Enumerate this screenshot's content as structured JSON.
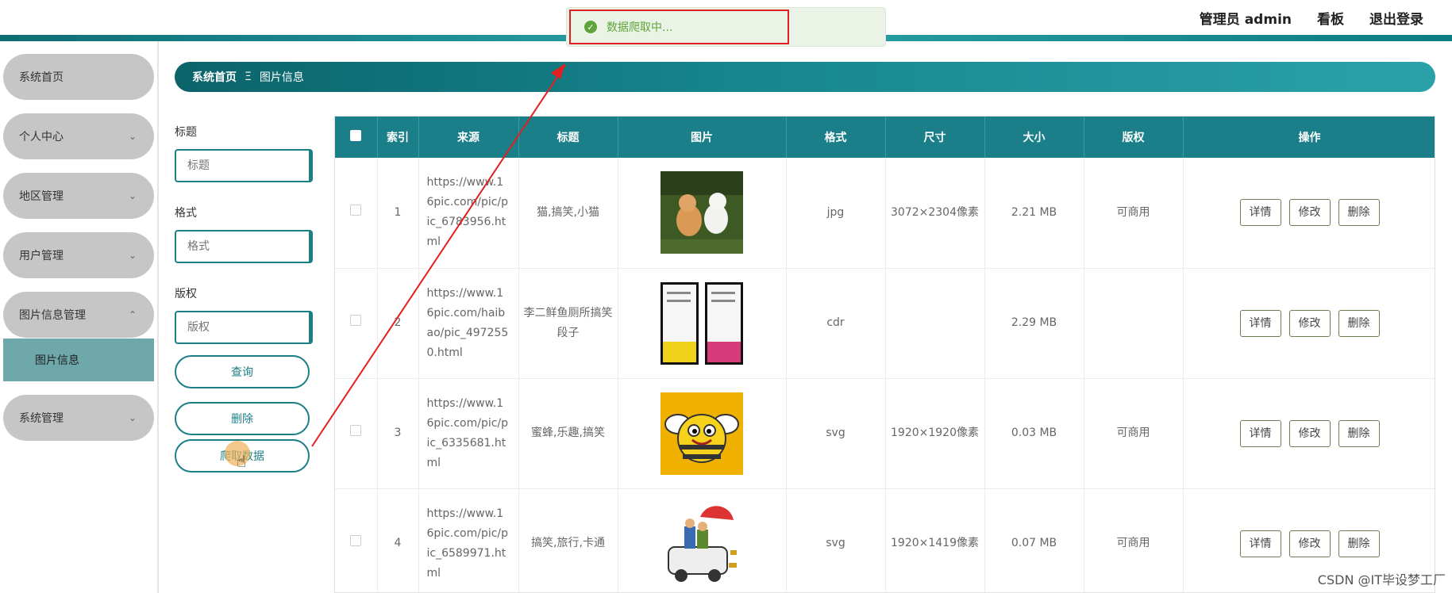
{
  "header": {
    "admin_label": "管理员 admin",
    "board_label": "看板",
    "logout_label": "退出登录"
  },
  "toast": {
    "message": "数据爬取中...",
    "icon": "check-circle-icon"
  },
  "sidebar": {
    "items": [
      {
        "label": "系统首页",
        "has_chevron": false
      },
      {
        "label": "个人中心",
        "chevron": "⌄"
      },
      {
        "label": "地区管理",
        "chevron": "⌄"
      },
      {
        "label": "用户管理",
        "chevron": "⌄"
      },
      {
        "label": "图片信息管理",
        "chevron": "⌃"
      },
      {
        "label": "系统管理",
        "chevron": "⌄"
      }
    ],
    "active_sub": "图片信息"
  },
  "breadcrumb": {
    "home": "系统首页",
    "separator": "Ξ",
    "current": "图片信息"
  },
  "filters": {
    "title_label": "标题",
    "title_placeholder": "标题",
    "format_label": "格式",
    "format_placeholder": "格式",
    "copyright_label": "版权",
    "copyright_placeholder": "版权",
    "search_button": "查询",
    "delete_button": "删除",
    "crawl_button": "爬取数据"
  },
  "table": {
    "headers": [
      "索引",
      "来源",
      "标题",
      "图片",
      "格式",
      "尺寸",
      "大小",
      "版权",
      "操作"
    ],
    "rows": [
      {
        "index": "1",
        "source": "https://www.16pic.com/pic/pic_6783956.html",
        "title": "猫,搞笑,小猫",
        "format": "jpg",
        "size": "3072×2304像素",
        "filesize": "2.21 MB",
        "copyright": "可商用"
      },
      {
        "index": "2",
        "source": "https://www.16pic.com/haibao/pic_4972550.html",
        "title": "李二鲜鱼厕所搞笑段子",
        "format": "cdr",
        "size": "",
        "filesize": "2.29 MB",
        "copyright": ""
      },
      {
        "index": "3",
        "source": "https://www.16pic.com/pic/pic_6335681.html",
        "title": "蜜蜂,乐趣,搞笑",
        "format": "svg",
        "size": "1920×1920像素",
        "filesize": "0.03 MB",
        "copyright": "可商用"
      },
      {
        "index": "4",
        "source": "https://www.16pic.com/pic/pic_6589971.html",
        "title": "搞笑,旅行,卡通",
        "format": "svg",
        "size": "1920×1419像素",
        "filesize": "0.07 MB",
        "copyright": "可商用"
      }
    ],
    "actions": {
      "detail": "详情",
      "edit": "修改",
      "delete": "删除"
    }
  },
  "watermark": "CSDN @IT毕设梦工厂",
  "colors": {
    "teal": "#1a7f88",
    "toast_green": "#5ea43a",
    "annotation_red": "#e02020",
    "sidebar_gray": "#c6c6c6"
  }
}
